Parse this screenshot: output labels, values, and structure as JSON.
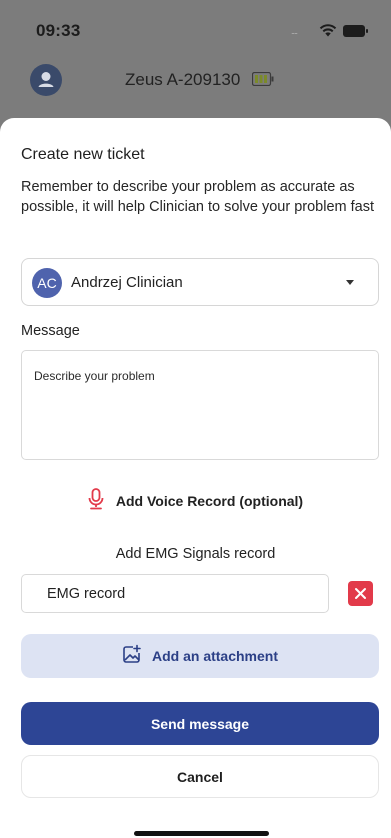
{
  "status_bar": {
    "time": "09:33",
    "signal_text": "....",
    "icons": [
      "wifi-icon",
      "battery-icon"
    ]
  },
  "header": {
    "device_name": "Zeus A-209130",
    "icons": [
      "user-avatar-icon",
      "device-battery-icon"
    ]
  },
  "ticket": {
    "title": "Create new ticket",
    "description": "Remember to describe your problem as accurate as possible, it will help Clinician to solve your problem fast",
    "recipient": {
      "initials": "AC",
      "name": "Andrzej Clinician"
    },
    "message_label": "Message",
    "message_placeholder": "Describe your problem",
    "message_value": "",
    "voice_label": "Add Voice Record (optional)",
    "emg_title": "Add EMG Signals record",
    "emg_value": "EMG record",
    "attach_label": "Add an attachment",
    "send_label": "Send message",
    "cancel_label": "Cancel"
  },
  "colors": {
    "primary": "#2d4595",
    "primary_light": "#dde3f3",
    "danger": "#e23a4a",
    "avatar": "#4f63ad",
    "backdrop": "#7c7c7c"
  }
}
